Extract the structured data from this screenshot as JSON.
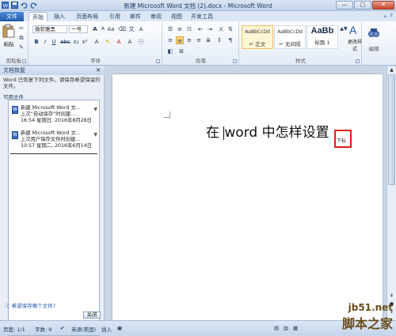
{
  "window": {
    "title": "新建 Microsoft Word 文档 (2).docx - Microsoft Word",
    "minimize": "—",
    "maximize": "□",
    "close": "✕"
  },
  "tabs": [
    "文件",
    "开始",
    "插入",
    "页面布局",
    "引用",
    "邮件",
    "审阅",
    "视图",
    "开发工具"
  ],
  "ribbon": {
    "clipboard": {
      "paste": "粘贴",
      "label": "剪贴板"
    },
    "font": {
      "name": "微软雅黑",
      "size": "一号",
      "label": "字体"
    },
    "paragraph": {
      "label": "段落"
    },
    "styles": {
      "label": "样式",
      "items": [
        {
          "sample": "AaBbCcDd",
          "name": "↵ 正文"
        },
        {
          "sample": "AaBbCcDd",
          "name": "↵ 无间隔"
        },
        {
          "sample": "AaBb",
          "name": "标题 1"
        }
      ],
      "change": "更改样式"
    },
    "editing": {
      "label": "编辑"
    }
  },
  "recovery": {
    "header": "文档恢复",
    "message": "Word 已恢复下列文件。请保存希望保留的文件。",
    "available": "可用文件",
    "files": [
      {
        "name": "新建 Microsoft Word 文...",
        "desc": "上次“自动保存”时创建...",
        "time": "16:54 星期日, 2016年8月28日"
      },
      {
        "name": "新建 Microsoft Word 文...",
        "desc": "上次用户保存文件时创建...",
        "time": "10:57 星期二, 2016年6月14日"
      }
    ],
    "which_link": "希望保存哪个文件?",
    "close_button": "关闭"
  },
  "document": {
    "text_before": "在 ",
    "text_after": "word 中怎样设置",
    "subscript": "下标"
  },
  "statusbar": {
    "page": "页面: 1/1",
    "words": "字数: 9",
    "language": "英语(美国)",
    "mode": "插入"
  },
  "watermark": {
    "line1": "jb51.net",
    "line2": "脚本之家"
  }
}
